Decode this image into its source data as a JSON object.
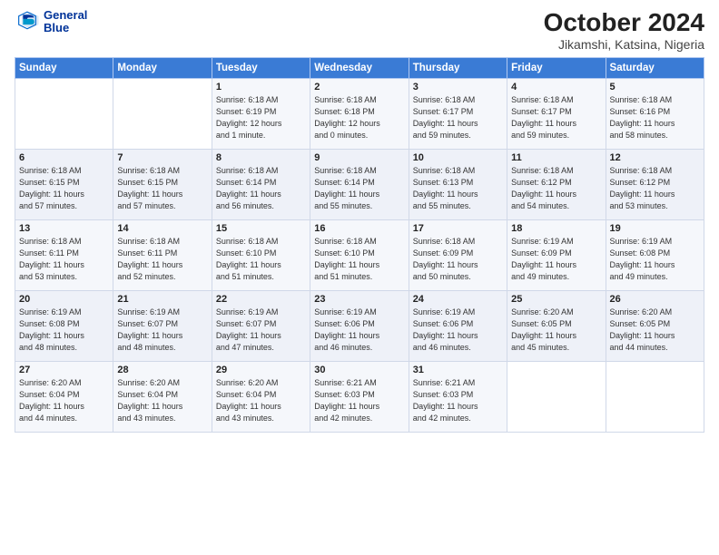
{
  "logo": {
    "line1": "General",
    "line2": "Blue"
  },
  "title": "October 2024",
  "subtitle": "Jikamshi, Katsina, Nigeria",
  "days_of_week": [
    "Sunday",
    "Monday",
    "Tuesday",
    "Wednesday",
    "Thursday",
    "Friday",
    "Saturday"
  ],
  "weeks": [
    [
      {
        "day": "",
        "info": ""
      },
      {
        "day": "",
        "info": ""
      },
      {
        "day": "1",
        "info": "Sunrise: 6:18 AM\nSunset: 6:19 PM\nDaylight: 12 hours\nand 1 minute."
      },
      {
        "day": "2",
        "info": "Sunrise: 6:18 AM\nSunset: 6:18 PM\nDaylight: 12 hours\nand 0 minutes."
      },
      {
        "day": "3",
        "info": "Sunrise: 6:18 AM\nSunset: 6:17 PM\nDaylight: 11 hours\nand 59 minutes."
      },
      {
        "day": "4",
        "info": "Sunrise: 6:18 AM\nSunset: 6:17 PM\nDaylight: 11 hours\nand 59 minutes."
      },
      {
        "day": "5",
        "info": "Sunrise: 6:18 AM\nSunset: 6:16 PM\nDaylight: 11 hours\nand 58 minutes."
      }
    ],
    [
      {
        "day": "6",
        "info": "Sunrise: 6:18 AM\nSunset: 6:15 PM\nDaylight: 11 hours\nand 57 minutes."
      },
      {
        "day": "7",
        "info": "Sunrise: 6:18 AM\nSunset: 6:15 PM\nDaylight: 11 hours\nand 57 minutes."
      },
      {
        "day": "8",
        "info": "Sunrise: 6:18 AM\nSunset: 6:14 PM\nDaylight: 11 hours\nand 56 minutes."
      },
      {
        "day": "9",
        "info": "Sunrise: 6:18 AM\nSunset: 6:14 PM\nDaylight: 11 hours\nand 55 minutes."
      },
      {
        "day": "10",
        "info": "Sunrise: 6:18 AM\nSunset: 6:13 PM\nDaylight: 11 hours\nand 55 minutes."
      },
      {
        "day": "11",
        "info": "Sunrise: 6:18 AM\nSunset: 6:12 PM\nDaylight: 11 hours\nand 54 minutes."
      },
      {
        "day": "12",
        "info": "Sunrise: 6:18 AM\nSunset: 6:12 PM\nDaylight: 11 hours\nand 53 minutes."
      }
    ],
    [
      {
        "day": "13",
        "info": "Sunrise: 6:18 AM\nSunset: 6:11 PM\nDaylight: 11 hours\nand 53 minutes."
      },
      {
        "day": "14",
        "info": "Sunrise: 6:18 AM\nSunset: 6:11 PM\nDaylight: 11 hours\nand 52 minutes."
      },
      {
        "day": "15",
        "info": "Sunrise: 6:18 AM\nSunset: 6:10 PM\nDaylight: 11 hours\nand 51 minutes."
      },
      {
        "day": "16",
        "info": "Sunrise: 6:18 AM\nSunset: 6:10 PM\nDaylight: 11 hours\nand 51 minutes."
      },
      {
        "day": "17",
        "info": "Sunrise: 6:18 AM\nSunset: 6:09 PM\nDaylight: 11 hours\nand 50 minutes."
      },
      {
        "day": "18",
        "info": "Sunrise: 6:19 AM\nSunset: 6:09 PM\nDaylight: 11 hours\nand 49 minutes."
      },
      {
        "day": "19",
        "info": "Sunrise: 6:19 AM\nSunset: 6:08 PM\nDaylight: 11 hours\nand 49 minutes."
      }
    ],
    [
      {
        "day": "20",
        "info": "Sunrise: 6:19 AM\nSunset: 6:08 PM\nDaylight: 11 hours\nand 48 minutes."
      },
      {
        "day": "21",
        "info": "Sunrise: 6:19 AM\nSunset: 6:07 PM\nDaylight: 11 hours\nand 48 minutes."
      },
      {
        "day": "22",
        "info": "Sunrise: 6:19 AM\nSunset: 6:07 PM\nDaylight: 11 hours\nand 47 minutes."
      },
      {
        "day": "23",
        "info": "Sunrise: 6:19 AM\nSunset: 6:06 PM\nDaylight: 11 hours\nand 46 minutes."
      },
      {
        "day": "24",
        "info": "Sunrise: 6:19 AM\nSunset: 6:06 PM\nDaylight: 11 hours\nand 46 minutes."
      },
      {
        "day": "25",
        "info": "Sunrise: 6:20 AM\nSunset: 6:05 PM\nDaylight: 11 hours\nand 45 minutes."
      },
      {
        "day": "26",
        "info": "Sunrise: 6:20 AM\nSunset: 6:05 PM\nDaylight: 11 hours\nand 44 minutes."
      }
    ],
    [
      {
        "day": "27",
        "info": "Sunrise: 6:20 AM\nSunset: 6:04 PM\nDaylight: 11 hours\nand 44 minutes."
      },
      {
        "day": "28",
        "info": "Sunrise: 6:20 AM\nSunset: 6:04 PM\nDaylight: 11 hours\nand 43 minutes."
      },
      {
        "day": "29",
        "info": "Sunrise: 6:20 AM\nSunset: 6:04 PM\nDaylight: 11 hours\nand 43 minutes."
      },
      {
        "day": "30",
        "info": "Sunrise: 6:21 AM\nSunset: 6:03 PM\nDaylight: 11 hours\nand 42 minutes."
      },
      {
        "day": "31",
        "info": "Sunrise: 6:21 AM\nSunset: 6:03 PM\nDaylight: 11 hours\nand 42 minutes."
      },
      {
        "day": "",
        "info": ""
      },
      {
        "day": "",
        "info": ""
      }
    ]
  ]
}
